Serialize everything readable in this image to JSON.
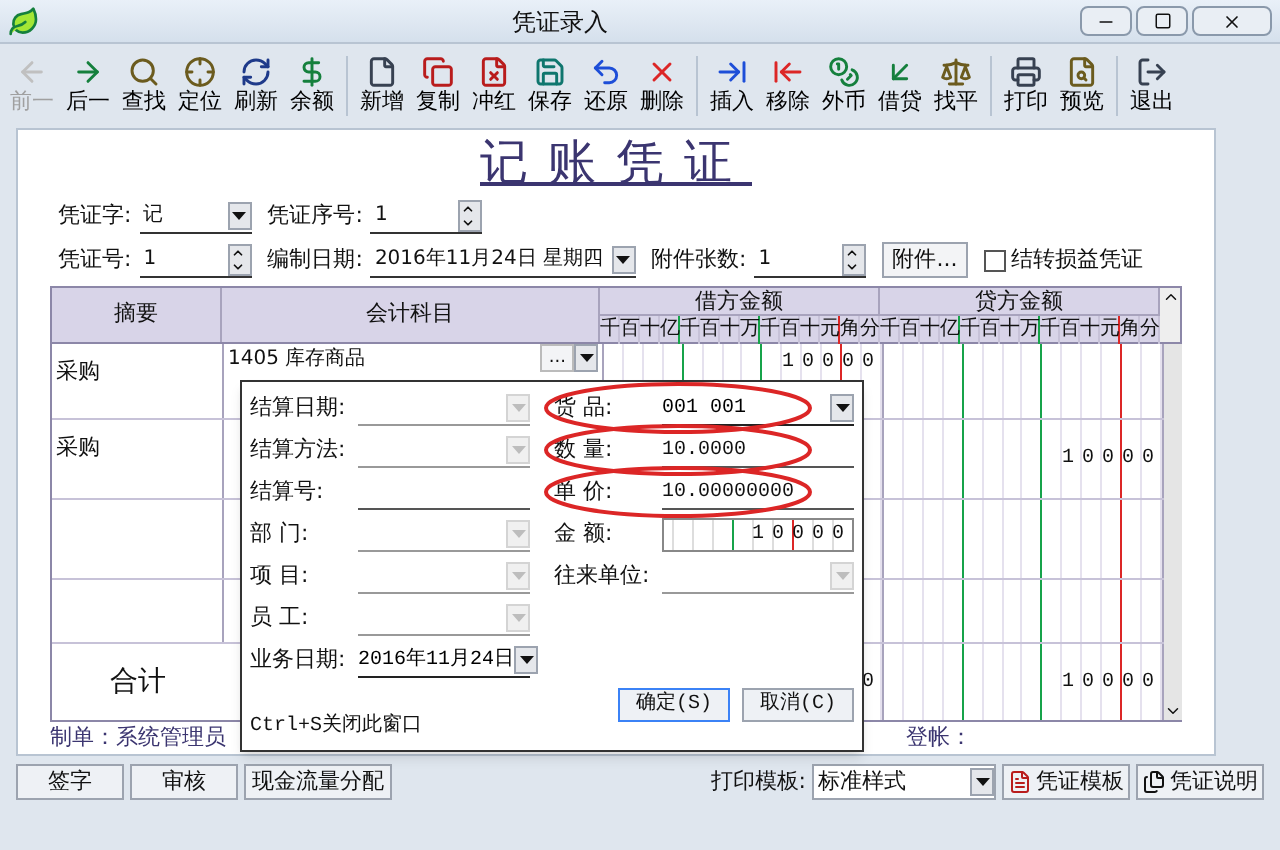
{
  "window": {
    "title": "凭证录入"
  },
  "toolbar": [
    [
      {
        "label": "前一",
        "disabled": true
      },
      {
        "label": "后一",
        "disabled": false
      },
      {
        "label": "查找",
        "disabled": false
      },
      {
        "label": "定位",
        "disabled": false
      },
      {
        "label": "刷新",
        "disabled": false
      },
      {
        "label": "余额",
        "disabled": false
      }
    ],
    [
      {
        "label": "新增",
        "disabled": false
      },
      {
        "label": "复制",
        "disabled": false
      },
      {
        "label": "冲红",
        "disabled": false
      },
      {
        "label": "保存",
        "disabled": false
      },
      {
        "label": "还原",
        "disabled": false
      },
      {
        "label": "删除",
        "disabled": false
      }
    ],
    [
      {
        "label": "插入",
        "disabled": false
      },
      {
        "label": "移除",
        "disabled": false
      },
      {
        "label": "外币",
        "disabled": false
      },
      {
        "label": "借贷",
        "disabled": false
      },
      {
        "label": "找平",
        "disabled": false
      }
    ],
    [
      {
        "label": "打印",
        "disabled": false
      },
      {
        "label": "预览",
        "disabled": false
      }
    ],
    [
      {
        "label": "退出",
        "disabled": false
      }
    ]
  ],
  "voucher_title": "记账凭证",
  "header": {
    "rows": [
      [
        {
          "kind": "dropdown",
          "label": "凭证字:",
          "value": "记"
        },
        {
          "kind": "spinner",
          "label": "凭证序号:",
          "value": "1"
        }
      ],
      [
        {
          "kind": "spinner",
          "label": "凭证号:",
          "value": "1"
        },
        {
          "kind": "dropdown",
          "label": "编制日期:",
          "value": "2016年11月24日 星期四"
        },
        {
          "kind": "spinner",
          "label": "附件张数:",
          "value": "1"
        },
        {
          "kind": "button",
          "label": "附件..."
        },
        {
          "kind": "checkbox",
          "label": "结转损益凭证",
          "checked": false
        }
      ]
    ]
  },
  "grid": {
    "columns": [
      "摘要",
      "会计科目",
      "借方金额",
      "贷方金额"
    ],
    "debit_digits": [
      "千",
      "百",
      "十",
      "亿",
      "千",
      "百",
      "十",
      "万",
      "千",
      "百",
      "十",
      "元",
      "角",
      "分"
    ],
    "credit_digits": [
      "千",
      "百",
      "十",
      "亿",
      "千",
      "百",
      "十",
      "万",
      "千",
      "百",
      "十",
      "元",
      "角",
      "分"
    ],
    "rows": [
      {
        "summary": "采购",
        "account": "1405 库存商品",
        "account_button": "...",
        "debit": "10000"
      },
      {
        "summary": "采购",
        "credit": "10000"
      }
    ],
    "total": {
      "label": "合计",
      "debit": "0",
      "credit": "10000"
    }
  },
  "footer": {
    "maker": "制单：系统管理员",
    "poster": "登帐："
  },
  "dialog": {
    "left_fields": [
      {
        "label": "结算日期:",
        "kind": "dropdown",
        "disabled": true
      },
      {
        "label": "结算方法:",
        "kind": "dropdown",
        "disabled": true
      },
      {
        "label": "结算号:",
        "kind": "text"
      },
      {
        "label": "部 门:",
        "kind": "dropdown",
        "disabled": true
      },
      {
        "label": "项 目:",
        "kind": "dropdown",
        "disabled": true
      },
      {
        "label": "员 工:",
        "kind": "dropdown",
        "disabled": true
      },
      {
        "label": "业务日期:",
        "kind": "dropdown",
        "disabled": false,
        "value": "2016年11月24日"
      }
    ],
    "right_fields": [
      {
        "label": "货 品:",
        "kind": "dropdown",
        "disabled": false,
        "value": "001 001",
        "highlighted": true
      },
      {
        "label": "数 量:",
        "kind": "text",
        "value": "10.0000",
        "highlighted": true
      },
      {
        "label": "单 价:",
        "kind": "text",
        "value": "10.00000000",
        "highlighted": true
      },
      {
        "label": "金 额:",
        "kind": "amount",
        "value": "10000",
        "highlighted": false
      },
      {
        "label": "往来单位:",
        "kind": "dropdown",
        "disabled": true,
        "highlighted": false
      }
    ],
    "hint": "Ctrl+S关闭此窗口",
    "buttons": [
      "确定(S)",
      "取消(C)"
    ]
  },
  "bottom_bar": {
    "buttons": [
      "签字",
      "审核",
      "现金流量分配"
    ],
    "print_template": {
      "label": "打印模板:",
      "value": "标准样式"
    },
    "tool_buttons": [
      "凭证模板",
      "凭证说明"
    ]
  }
}
